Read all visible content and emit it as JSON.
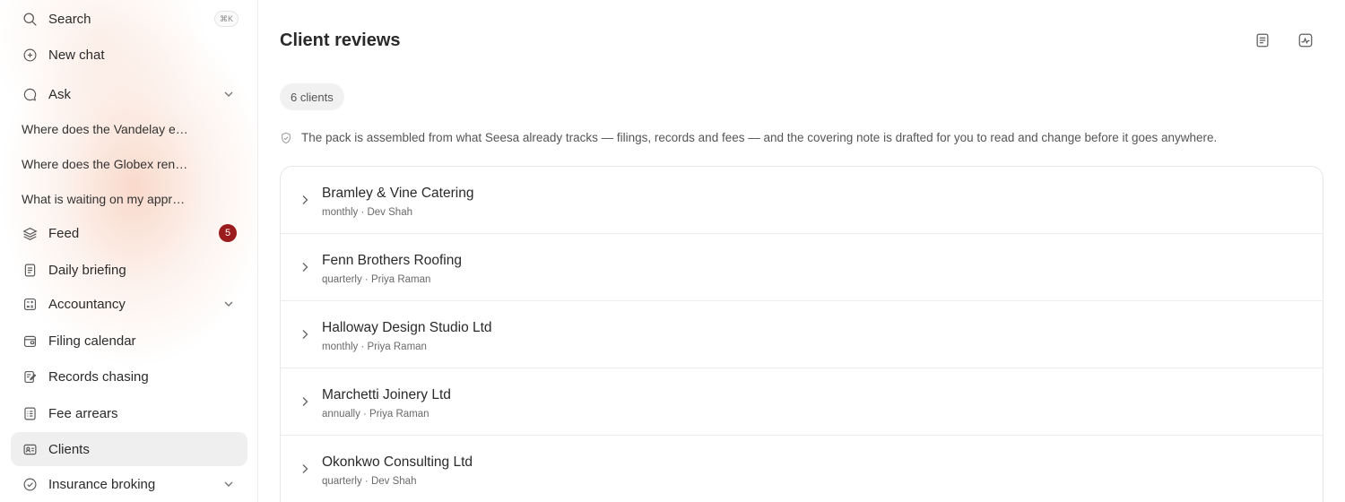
{
  "sidebar": {
    "search": {
      "label": "Search",
      "shortcut": "⌘K"
    },
    "new_chat": {
      "label": "New chat"
    },
    "ask": {
      "label": "Ask"
    },
    "chats": [
      "Where does the Vandelay engagement stand?",
      "Where does the Globex renewal stand?",
      "What is waiting on my approval?"
    ],
    "feed": {
      "label": "Feed",
      "badge": "5"
    },
    "daily_briefing": {
      "label": "Daily briefing"
    },
    "accountancy": {
      "label": "Accountancy"
    },
    "filing_calendar": {
      "label": "Filing calendar"
    },
    "records_chasing": {
      "label": "Records chasing"
    },
    "fee_arrears": {
      "label": "Fee arrears"
    },
    "clients": {
      "label": "Clients"
    },
    "insurance_broking": {
      "label": "Insurance broking"
    }
  },
  "main": {
    "title": "Client reviews",
    "count_pill": "6 clients",
    "note": "The pack is assembled from what Seesa already tracks — filings, records and fees — and the covering note is drafted for you to read and change before it goes anywhere.",
    "clients": [
      {
        "name": "Bramley & Vine Catering",
        "meta": "monthly · Dev Shah"
      },
      {
        "name": "Fenn Brothers Roofing",
        "meta": "quarterly · Priya Raman"
      },
      {
        "name": "Halloway Design Studio Ltd",
        "meta": "monthly · Priya Raman"
      },
      {
        "name": "Marchetti Joinery Ltd",
        "meta": "annually · Priya Raman"
      },
      {
        "name": "Okonkwo Consulting Ltd",
        "meta": "quarterly · Dev Shah"
      }
    ]
  },
  "colors": {
    "badge": "#9b1c1c",
    "active_item": "#efefef"
  }
}
